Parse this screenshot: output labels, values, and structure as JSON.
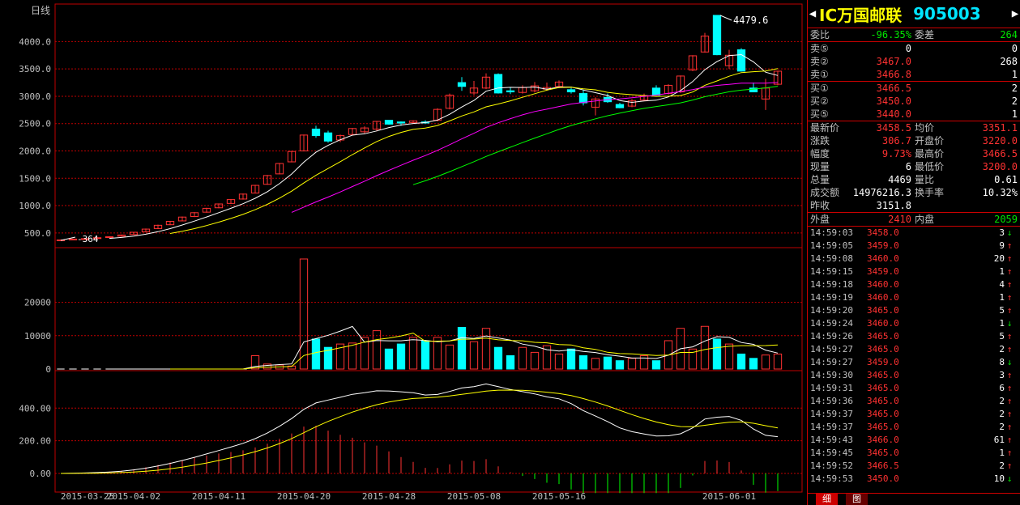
{
  "chart": {
    "period_label": "日线",
    "main_y_ticks": [
      "4000.0",
      "3500.0",
      "3000.0",
      "2500.0",
      "2000.0",
      "1500.0",
      "1000.0",
      "500.0"
    ],
    "vol_y_ticks": [
      "20000",
      "10000",
      "0"
    ],
    "macd_y_ticks": [
      "400.00",
      "200.00",
      "0.00"
    ],
    "x_ticks": [
      "2015-03-25",
      "2015-04-02",
      "2015-04-11",
      "2015-04-20",
      "2015-04-28",
      "2015-05-08",
      "2015-05-16",
      "2015-06-01"
    ],
    "high_label": "4479.6",
    "low_label": "364",
    "colors": {
      "up": "#ff3232",
      "down": "#00ffff",
      "ma5": "#ffffff",
      "ma10": "#ffff00",
      "ma20": "#ff00ff",
      "ma60": "#00ff00",
      "grid": "#c00000"
    }
  },
  "chart_data": {
    "type": "candlestick",
    "title": "",
    "candles": [
      [
        364,
        380,
        360,
        372
      ],
      [
        372,
        392,
        370,
        388
      ],
      [
        388,
        400,
        380,
        395
      ],
      [
        400,
        420,
        398,
        412
      ],
      [
        420,
        440,
        415,
        430
      ],
      [
        440,
        470,
        435,
        462
      ],
      [
        470,
        520,
        462,
        512
      ],
      [
        520,
        580,
        515,
        570
      ],
      [
        580,
        650,
        572,
        640
      ],
      [
        650,
        720,
        642,
        712
      ],
      [
        720,
        800,
        712,
        790
      ],
      [
        800,
        880,
        790,
        870
      ],
      [
        880,
        960,
        870,
        950
      ],
      [
        960,
        1040,
        950,
        1030
      ],
      [
        1040,
        1120,
        1030,
        1110
      ],
      [
        1120,
        1220,
        1110,
        1210
      ],
      [
        1230,
        1380,
        1220,
        1370
      ],
      [
        1390,
        1560,
        1380,
        1550
      ],
      [
        1580,
        1780,
        1570,
        1770
      ],
      [
        1800,
        2000,
        1790,
        1990
      ],
      [
        2000,
        2300,
        1990,
        2290
      ],
      [
        2400,
        2460,
        2240,
        2280
      ],
      [
        2330,
        2370,
        2150,
        2180
      ],
      [
        2200,
        2300,
        2160,
        2280
      ],
      [
        2300,
        2420,
        2290,
        2410
      ],
      [
        2350,
        2450,
        2320,
        2420
      ],
      [
        2400,
        2550,
        2360,
        2540
      ],
      [
        2560,
        2560,
        2480,
        2490
      ],
      [
        2530,
        2540,
        2460,
        2510
      ],
      [
        2520,
        2560,
        2500,
        2550
      ],
      [
        2530,
        2560,
        2500,
        2510
      ],
      [
        2560,
        2780,
        2540,
        2760
      ],
      [
        2780,
        3050,
        2760,
        3020
      ],
      [
        3250,
        3350,
        3100,
        3180
      ],
      [
        3060,
        3280,
        3020,
        3150
      ],
      [
        3150,
        3420,
        3130,
        3350
      ],
      [
        3400,
        3420,
        3050,
        3060
      ],
      [
        3100,
        3160,
        3040,
        3080
      ],
      [
        3070,
        3200,
        3050,
        3160
      ],
      [
        3100,
        3260,
        3070,
        3190
      ],
      [
        3130,
        3250,
        3100,
        3160
      ],
      [
        3180,
        3290,
        3150,
        3260
      ],
      [
        3120,
        3150,
        3050,
        3080
      ],
      [
        3050,
        3120,
        2830,
        2880
      ],
      [
        2800,
        2980,
        2650,
        2950
      ],
      [
        2980,
        3050,
        2880,
        2900
      ],
      [
        2850,
        2880,
        2780,
        2790
      ],
      [
        2820,
        2950,
        2800,
        2920
      ],
      [
        2930,
        3050,
        2920,
        3010
      ],
      [
        3150,
        3200,
        3010,
        3020
      ],
      [
        3050,
        3220,
        3030,
        3200
      ],
      [
        3080,
        3380,
        3060,
        3370
      ],
      [
        3480,
        3750,
        3460,
        3740
      ],
      [
        3810,
        4160,
        3800,
        4100
      ],
      [
        4479.6,
        4479.6,
        3750,
        3760
      ],
      [
        3560,
        3850,
        3500,
        3750
      ],
      [
        3850,
        3880,
        3450,
        3460
      ],
      [
        3150,
        3250,
        3080,
        3080
      ],
      [
        2950,
        3320,
        2750,
        3150
      ],
      [
        3220,
        3466.5,
        3200,
        3458.5
      ]
    ],
    "volume": [
      0,
      0,
      0,
      0,
      0,
      0,
      0,
      0,
      0,
      0,
      0,
      0,
      0,
      0,
      0,
      0,
      4000,
      1500,
      1200,
      900,
      33000,
      9000,
      6500,
      7500,
      7800,
      9500,
      11500,
      6000,
      7500,
      9500,
      8500,
      9500,
      7200,
      12500,
      8200,
      12200,
      6500,
      4000,
      6500,
      5000,
      7000,
      4500,
      6000,
      4000,
      3200,
      3600,
      2500,
      3200,
      4000,
      2500,
      8500,
      12200,
      6000,
      12800,
      9000,
      7500,
      4500,
      3200,
      4200,
      4500
    ],
    "macd_label": "MACD"
  },
  "quote": {
    "title": "IC万国邮联",
    "code": "905003",
    "weibi": {
      "label": "委比",
      "value": "-96.35%",
      "diff_label": "委差",
      "diff": "264"
    },
    "sells": [
      {
        "label": "卖⑤",
        "price": "0",
        "vol": "0"
      },
      {
        "label": "卖②",
        "price": "3467.0",
        "vol": "268"
      },
      {
        "label": "卖①",
        "price": "3466.8",
        "vol": "1"
      }
    ],
    "buys": [
      {
        "label": "买①",
        "price": "3466.5",
        "vol": "2"
      },
      {
        "label": "买②",
        "price": "3450.0",
        "vol": "2"
      },
      {
        "label": "买⑤",
        "price": "3440.0",
        "vol": "1"
      }
    ],
    "stats": [
      {
        "l1": "最新价",
        "v1": "3458.5",
        "c1": "red",
        "l2": "均价",
        "v2": "3351.1",
        "c2": "red"
      },
      {
        "l1": "涨跌",
        "v1": "306.7",
        "c1": "red",
        "l2": "开盘价",
        "v2": "3220.0",
        "c2": "red"
      },
      {
        "l1": "幅度",
        "v1": "9.73%",
        "c1": "red",
        "l2": "最高价",
        "v2": "3466.5",
        "c2": "red"
      },
      {
        "l1": "现量",
        "v1": "6",
        "c1": "wht",
        "l2": "最低价",
        "v2": "3200.0",
        "c2": "red"
      },
      {
        "l1": "总量",
        "v1": "4469",
        "c1": "wht",
        "l2": "量比",
        "v2": "0.61",
        "c2": "wht"
      },
      {
        "l1": "成交额",
        "v1": "14976216.3",
        "c1": "wht",
        "l2": "换手率",
        "v2": "10.32%",
        "c2": "wht"
      },
      {
        "l1": "昨收",
        "v1": "3151.8",
        "c1": "wht",
        "l2": "",
        "v2": "",
        "c2": "wht"
      }
    ],
    "outer": {
      "label": "外盘",
      "value": "2410",
      "inner_label": "内盘",
      "inner": "2059"
    },
    "ticks": [
      {
        "time": "14:59:03",
        "price": "3458.0",
        "vol": "3",
        "dir": "↓"
      },
      {
        "time": "14:59:05",
        "price": "3459.0",
        "vol": "9",
        "dir": "↑"
      },
      {
        "time": "14:59:08",
        "price": "3460.0",
        "vol": "20",
        "dir": "↑"
      },
      {
        "time": "14:59:15",
        "price": "3459.0",
        "vol": "1",
        "dir": "↑"
      },
      {
        "time": "14:59:18",
        "price": "3460.0",
        "vol": "4",
        "dir": "↑"
      },
      {
        "time": "14:59:19",
        "price": "3460.0",
        "vol": "1",
        "dir": "↑"
      },
      {
        "time": "14:59:20",
        "price": "3465.0",
        "vol": "5",
        "dir": "↑"
      },
      {
        "time": "14:59:24",
        "price": "3460.0",
        "vol": "1",
        "dir": "↓"
      },
      {
        "time": "14:59:26",
        "price": "3465.0",
        "vol": "5",
        "dir": "↑"
      },
      {
        "time": "14:59:27",
        "price": "3465.0",
        "vol": "2",
        "dir": "↑"
      },
      {
        "time": "14:59:27",
        "price": "3459.0",
        "vol": "8",
        "dir": "↓"
      },
      {
        "time": "14:59:30",
        "price": "3465.0",
        "vol": "3",
        "dir": "↑"
      },
      {
        "time": "14:59:31",
        "price": "3465.0",
        "vol": "6",
        "dir": "↑"
      },
      {
        "time": "14:59:36",
        "price": "3465.0",
        "vol": "2",
        "dir": "↑"
      },
      {
        "time": "14:59:37",
        "price": "3465.0",
        "vol": "2",
        "dir": "↑"
      },
      {
        "time": "14:59:37",
        "price": "3465.0",
        "vol": "2",
        "dir": "↑"
      },
      {
        "time": "14:59:43",
        "price": "3466.0",
        "vol": "61",
        "dir": "↑"
      },
      {
        "time": "14:59:45",
        "price": "3465.0",
        "vol": "1",
        "dir": "↑"
      },
      {
        "time": "14:59:52",
        "price": "3466.5",
        "vol": "2",
        "dir": "↑"
      },
      {
        "time": "14:59:53",
        "price": "3450.0",
        "vol": "10",
        "dir": "↓"
      }
    ],
    "tabs": [
      "细",
      "图"
    ]
  }
}
